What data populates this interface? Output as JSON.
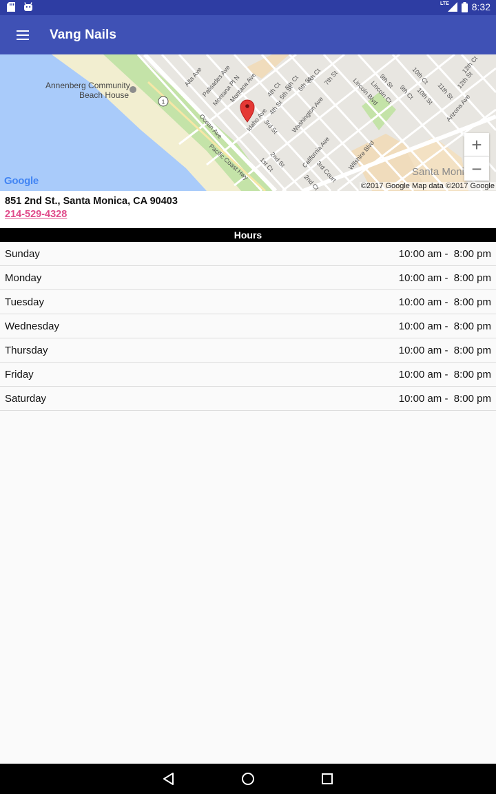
{
  "status_bar": {
    "network": "LTE",
    "time": "8:32"
  },
  "app_bar": {
    "title": "Vang Nails",
    "menu_icon": "hamburger-menu-icon"
  },
  "map": {
    "place_label_line1": "Annenberg Community",
    "place_label_line2": "Beach House",
    "route_shield": "1",
    "area_label": "Santa Monica",
    "streets": {
      "alta": "Alta Ave",
      "palisades": "Palisades Ave",
      "montana_pl": "Montana Pl N",
      "montana": "Montana Ave",
      "fourth_ct": "4th Ct",
      "fifth_ct": "5th Ct",
      "fifth_st": "5th St",
      "sixth_ct": "6th Ct",
      "sixth_st": "6th St",
      "seventh_st": "7th St",
      "fourth_st": "4th St",
      "lincoln_blvd": "Lincoln Blvd",
      "lincoln_ct": "Lincoln Ct",
      "ninth_st": "9th St",
      "ninth_ct": "9th Ct",
      "tenth_ct": "10th Ct",
      "tenth_st": "10th St",
      "eleventh_st": "11th St",
      "twelfth_ct": "12th Ct",
      "twelfth_st": "12th St",
      "arizona": "Arizona Ave",
      "ocean": "Ocean Ave",
      "idaho": "Idaho Ave",
      "third_st": "3rd St",
      "washington": "Washington Ave",
      "pch": "Pacific Coast Hwy",
      "second_st": "2nd St",
      "first_ct": "1st Ct",
      "california": "California Ave",
      "third_court": "3rd Court",
      "second_ct": "2nd Ct",
      "wilshire": "Wilshire Blvd"
    },
    "logo_text": "Google",
    "attribution": "©2017 Google  Map data ©2017 Google",
    "zoom_in": "+",
    "zoom_out": "−",
    "colors": {
      "water": "#a9cbfa",
      "park": "#c4e3a8",
      "beach": "#f2eed0",
      "marker": "#e53935"
    }
  },
  "location": {
    "address": "851 2nd St., Santa Monica, CA 90403",
    "phone": "214-529-4328"
  },
  "hours": {
    "title": "Hours",
    "rows": [
      {
        "day": "Sunday",
        "time": "10:00 am -  8:00 pm"
      },
      {
        "day": "Monday",
        "time": "10:00 am -  8:00 pm"
      },
      {
        "day": "Tuesday",
        "time": "10:00 am -  8:00 pm"
      },
      {
        "day": "Wednesday",
        "time": "10:00 am -  8:00 pm"
      },
      {
        "day": "Thursday",
        "time": "10:00 am -  8:00 pm"
      },
      {
        "day": "Friday",
        "time": "10:00 am -  8:00 pm"
      },
      {
        "day": "Saturday",
        "time": "10:00 am -  8:00 pm"
      }
    ]
  },
  "nav_bar": {
    "back_icon": "back-icon",
    "home_icon": "home-icon",
    "recents_icon": "recents-icon"
  }
}
